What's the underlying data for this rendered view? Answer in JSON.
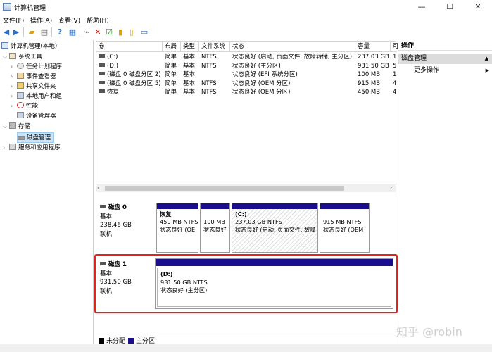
{
  "window": {
    "title": "计算机管理",
    "minimize": "—",
    "maximize": "☐",
    "close": "✕"
  },
  "menu": [
    "文件(F)",
    "操作(A)",
    "查看(V)",
    "帮助(H)"
  ],
  "toolbar_icons": [
    "back-icon",
    "forward-icon",
    "folder-icon",
    "console-tree-icon",
    "help-icon",
    "properties-icon",
    "connect-icon",
    "delete-icon",
    "check-icon",
    "open-icon",
    "new-icon",
    "list-icon"
  ],
  "tree": {
    "root": "计算机管理(本地)",
    "items": [
      {
        "label": "系统工具",
        "level": 1,
        "expanded": true
      },
      {
        "label": "任务计划程序",
        "level": 2
      },
      {
        "label": "事件查看器",
        "level": 2
      },
      {
        "label": "共享文件夹",
        "level": 2
      },
      {
        "label": "本地用户和组",
        "level": 2
      },
      {
        "label": "性能",
        "level": 2
      },
      {
        "label": "设备管理器",
        "level": 2
      },
      {
        "label": "存储",
        "level": 1,
        "expanded": true
      },
      {
        "label": "磁盘管理",
        "level": 2,
        "selected": true
      },
      {
        "label": "服务和应用程序",
        "level": 1
      }
    ]
  },
  "volumes": {
    "headers": [
      "卷",
      "布局",
      "类型",
      "文件系统",
      "状态",
      "容量",
      "可"
    ],
    "rows": [
      [
        "(C:)",
        "简单",
        "基本",
        "NTFS",
        "状态良好 (启动, 页面文件, 故障转储, 主分区)",
        "237.03 GB",
        "1"
      ],
      [
        "(D:)",
        "简单",
        "基本",
        "NTFS",
        "状态良好 (主分区)",
        "931.50 GB",
        "5"
      ],
      [
        "(磁盘 0 磁盘分区 2)",
        "简单",
        "基本",
        "",
        "状态良好 (EFI 系统分区)",
        "100 MB",
        "1"
      ],
      [
        "(磁盘 0 磁盘分区 5)",
        "简单",
        "基本",
        "NTFS",
        "状态良好 (OEM 分区)",
        "915 MB",
        "4"
      ],
      [
        "恢复",
        "简单",
        "基本",
        "NTFS",
        "状态良好 (OEM 分区)",
        "450 MB",
        "4"
      ]
    ]
  },
  "disks": [
    {
      "name": "磁盘 0",
      "type": "基本",
      "size": "238.46 GB",
      "status": "联机",
      "partitions": [
        {
          "name": "恢复",
          "size": "450 MB NTFS",
          "status": "状态良好 (OE"
        },
        {
          "name": "",
          "size": "100 MB",
          "status": "状态良好"
        },
        {
          "name": "(C:)",
          "size": "237.03 GB NTFS",
          "status": "状态良好 (启动, 页面文件, 故障"
        },
        {
          "name": "",
          "size": "915 MB NTFS",
          "status": "状态良好 (OEM"
        }
      ]
    },
    {
      "name": "磁盘 1",
      "type": "基本",
      "size": "931.50 GB",
      "status": "联机",
      "partitions": [
        {
          "name": "(D:)",
          "size": "931.50 GB NTFS",
          "status": "状态良好 (主分区)"
        }
      ]
    }
  ],
  "legend": [
    {
      "label": "未分配",
      "color": "#000000"
    },
    {
      "label": "主分区",
      "color": "#1b0e8c"
    }
  ],
  "actions": {
    "header": "操作",
    "section": "磁盘管理",
    "more": "更多操作"
  },
  "watermark": "知乎 @robin"
}
